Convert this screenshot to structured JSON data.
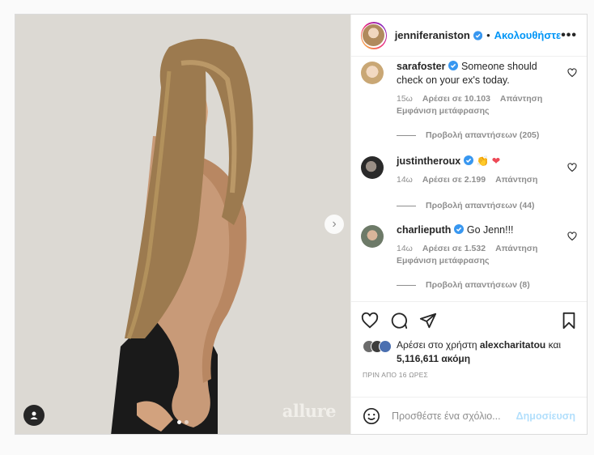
{
  "media": {
    "brand_label": "allure",
    "next_icon": "chevron-right-icon",
    "tag_icon": "user-tag-icon",
    "carousel": {
      "count": 2,
      "active": 1
    }
  },
  "header": {
    "username": "jenniferaniston",
    "separator": "•",
    "follow_label": "Ακολουθήστε",
    "more_label": "•••"
  },
  "comments": [
    {
      "username": "sarafoster",
      "text": "Someone should check on your ex's today.",
      "time": "15ω",
      "likes": "Αρέσει σε 10.103",
      "reply": "Απάντηση",
      "translate": "Εμφάνιση μετάφρασης",
      "replies": "Προβολή απαντήσεων (205)"
    },
    {
      "username": "justintheroux",
      "text": "👏 ❤",
      "time": "14ω",
      "likes": "Αρέσει σε 2.199",
      "reply": "Απάντηση",
      "translate": "",
      "replies": "Προβολή απαντήσεων (44)"
    },
    {
      "username": "charlieputh",
      "text": "Go Jenn!!!",
      "time": "14ω",
      "likes": "Αρέσει σε 1.532",
      "reply": "Απάντηση",
      "translate": "Εμφάνιση μετάφρασης",
      "replies": "Προβολή απαντήσεων (8)"
    }
  ],
  "likes": {
    "prefix": "Αρέσει στο χρήστη",
    "user": "alexcharitatou",
    "conj": "και",
    "count": "5,116,611 ακόμη"
  },
  "timeago": "ΠΡΙΝ ΑΠΟ 16 ΩΡΕΣ",
  "add_comment": {
    "placeholder": "Προσθέστε ένα σχόλιο...",
    "post_label": "Δημοσίευση"
  },
  "colors": {
    "accent": "#0095f6",
    "verified": "#3897f0",
    "heart": "#ed4956"
  }
}
